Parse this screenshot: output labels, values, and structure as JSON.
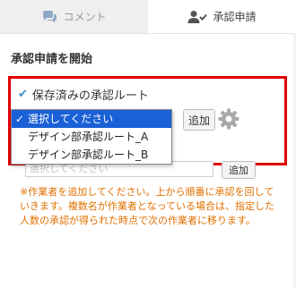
{
  "tabs": [
    {
      "label": "コメント",
      "icon": "comment-icon"
    },
    {
      "label": "承認申請",
      "icon": "user-check-icon"
    }
  ],
  "section_title": "承認申請を開始",
  "saved_routes": {
    "check_icon": "check-icon",
    "label": "保存済みの承認ルート"
  },
  "route_select": {
    "options": [
      "選択してください",
      "デザイン部承認ルート_A",
      "デザイン部承認ルート_B"
    ],
    "selected": "選択してください",
    "selected_tick": "✓"
  },
  "add_button_label": "追加",
  "settings_icon": "gear-icon",
  "worker_input": {
    "placeholder": "選択してください",
    "add_label": "追加"
  },
  "note": "※作業者を追加してください。上から順番に承認を回していきます。複数名が作業者となっている場合は、指定した人数の承認が得られた時点で次の作業者に移ります。",
  "colors": {
    "highlight_border": "#e00000",
    "selected_option_bg": "#1a60d6",
    "note_text": "#e07000",
    "check": "#3a8fc8"
  }
}
